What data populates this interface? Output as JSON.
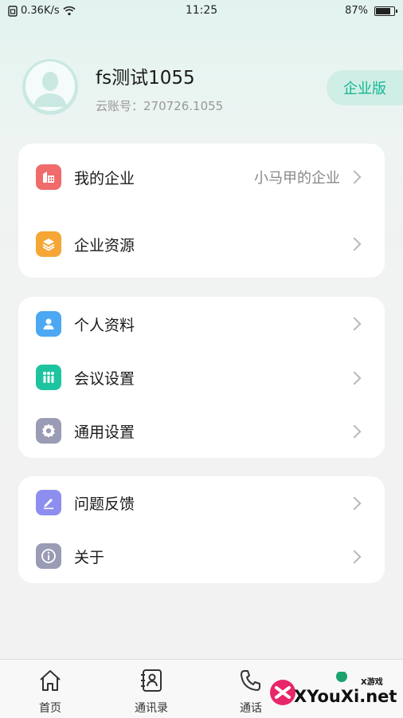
{
  "status_bar": {
    "network_speed": "0.36K/s",
    "time": "11:25",
    "battery_percent": "87%",
    "battery_level": 0.87
  },
  "profile": {
    "name": "fs测试1055",
    "account": "云账号：270726.1055",
    "edition_badge": "企业版"
  },
  "groups": [
    {
      "items": [
        {
          "label": "我的企业",
          "value": "小马甲的企业",
          "icon": "enterprise-icon",
          "color": "#f06b6b"
        },
        {
          "label": "企业资源",
          "value": "",
          "icon": "resources-icon",
          "color": "#f5a634"
        }
      ]
    },
    {
      "items": [
        {
          "label": "个人资料",
          "value": "",
          "icon": "profile-icon",
          "color": "#4ca8f2"
        },
        {
          "label": "会议设置",
          "value": "",
          "icon": "meeting-icon",
          "color": "#1cc4a0"
        },
        {
          "label": "通用设置",
          "value": "",
          "icon": "gear-icon",
          "color": "#9a9bb4"
        }
      ]
    },
    {
      "items": [
        {
          "label": "问题反馈",
          "value": "",
          "icon": "feedback-icon",
          "color": "#8e8ef0"
        },
        {
          "label": "关于",
          "value": "",
          "icon": "info-icon",
          "color": "#9a9bb4"
        }
      ]
    }
  ],
  "bottom_nav": [
    {
      "label": "首页",
      "icon": "home-icon"
    },
    {
      "label": "通讯录",
      "icon": "contacts-icon"
    },
    {
      "label": "通话",
      "icon": "phone-icon"
    }
  ],
  "watermark": {
    "text": "XYouXi.net",
    "sub": "X游戏"
  },
  "colors": {
    "accent": "#14b794",
    "badge_bg": "#cfeee5"
  }
}
